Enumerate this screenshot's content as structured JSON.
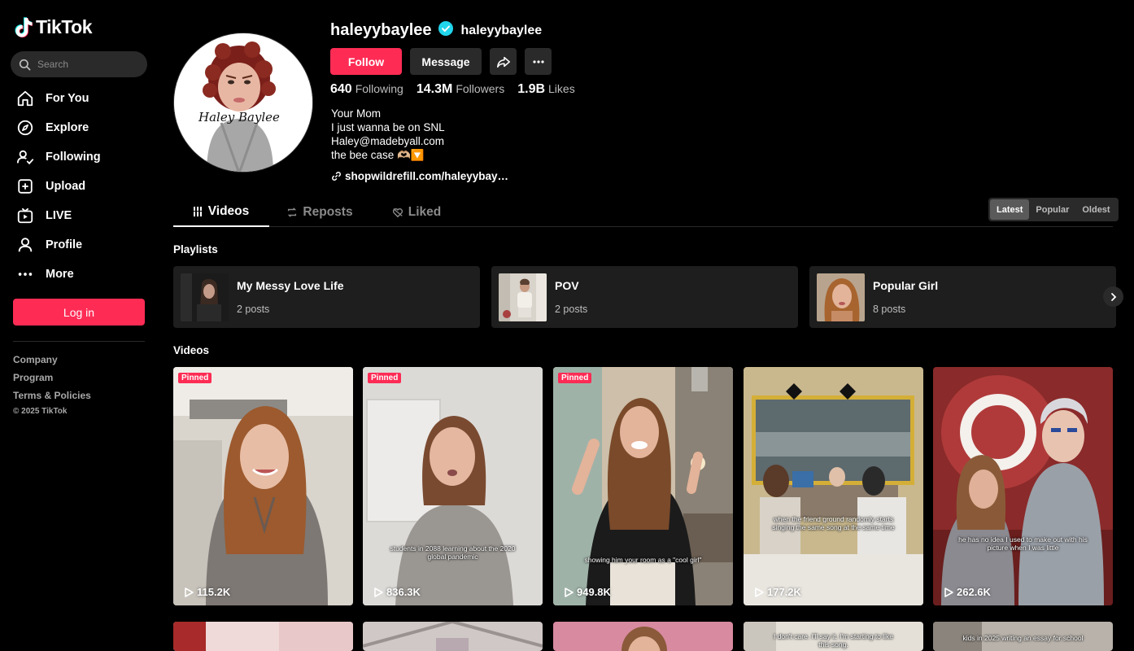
{
  "app": {
    "logo_text": "TikTok"
  },
  "search": {
    "placeholder": "Search"
  },
  "nav": {
    "items": [
      {
        "label": "For You",
        "icon": "home-icon"
      },
      {
        "label": "Explore",
        "icon": "compass-icon"
      },
      {
        "label": "Following",
        "icon": "following-icon"
      },
      {
        "label": "Upload",
        "icon": "upload-icon"
      },
      {
        "label": "LIVE",
        "icon": "live-icon"
      },
      {
        "label": "Profile",
        "icon": "profile-icon"
      },
      {
        "label": "More",
        "icon": "more-dots-icon"
      }
    ],
    "login_label": "Log in"
  },
  "footer": {
    "links": [
      "Company",
      "Program",
      "Terms & Policies"
    ],
    "copyright": "© 2025 TikTok"
  },
  "profile": {
    "username": "haleyybaylee",
    "display_name": "haleyybaylee",
    "verified": true,
    "follow_label": "Follow",
    "message_label": "Message",
    "stats": [
      {
        "value": "640",
        "label": "Following"
      },
      {
        "value": "14.3M",
        "label": "Followers"
      },
      {
        "value": "1.9B",
        "label": "Likes"
      }
    ],
    "bio_lines": [
      "Your Mom",
      "I just wanna be on SNL",
      "Haley@madebyall.com",
      "the bee case 🫶🏼🔽"
    ],
    "link": "shopwildrefill.com/haleyybay…",
    "avatar_signature": "Haley Baylee"
  },
  "tabs": {
    "items": [
      {
        "label": "Videos",
        "icon": "grid-icon",
        "active": true
      },
      {
        "label": "Reposts",
        "icon": "repost-icon",
        "active": false
      },
      {
        "label": "Liked",
        "icon": "liked-heart-icon",
        "active": false
      }
    ],
    "sort": [
      "Latest",
      "Popular",
      "Oldest"
    ],
    "sort_active": "Latest"
  },
  "playlists": {
    "title": "Playlists",
    "items": [
      {
        "title": "My Messy Love Life",
        "count": "2 posts"
      },
      {
        "title": "POV",
        "count": "2 posts"
      },
      {
        "title": "Popular Girl",
        "count": "8 posts"
      }
    ]
  },
  "videos": {
    "title": "Videos",
    "pinned_label": "Pinned",
    "items": [
      {
        "views": "115.2K",
        "pinned": true,
        "caption": ""
      },
      {
        "views": "836.3K",
        "pinned": true,
        "caption": "students in 2088 learning about the 2020 global pandemic"
      },
      {
        "views": "949.8K",
        "pinned": true,
        "caption": "showing him your room as a \"cool girl\""
      },
      {
        "views": "177.2K",
        "pinned": false,
        "caption": "when the friend ground randomly starts singing the same song at the same time"
      },
      {
        "views": "262.6K",
        "pinned": false,
        "caption": "he has no idea I used to make out with his picture when I was little"
      }
    ],
    "row2_captions": [
      "",
      "",
      "",
      "I don't care. I'll say it. I'm starting to like this song.",
      "kids in 2025 writing an essay for school"
    ]
  },
  "colors": {
    "accent": "#fe2c55",
    "verified": "#20d5ec",
    "background": "#000000",
    "surface": "#1e1e1e"
  }
}
